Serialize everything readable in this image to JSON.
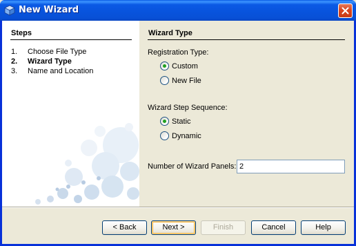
{
  "window": {
    "title": "New Wizard",
    "close_icon": "close-icon",
    "app_icon": "cube-icon"
  },
  "steps": {
    "title": "Steps",
    "items": [
      {
        "num": "1.",
        "label": "Choose File Type"
      },
      {
        "num": "2.",
        "label": "Wizard Type"
      },
      {
        "num": "3.",
        "label": "Name and Location"
      }
    ],
    "current_index": 1
  },
  "content": {
    "title": "Wizard Type",
    "registration": {
      "label": "Registration Type:",
      "options": [
        {
          "label": "Custom",
          "checked": true
        },
        {
          "label": "New File",
          "checked": false
        }
      ]
    },
    "sequence": {
      "label": "Wizard Step Sequence:",
      "options": [
        {
          "label": "Static",
          "checked": true
        },
        {
          "label": "Dynamic",
          "checked": false
        }
      ]
    },
    "panels": {
      "label": "Number of Wizard Panels:",
      "value": "2"
    }
  },
  "buttons": {
    "back": "< Back",
    "next": "Next >",
    "finish": "Finish",
    "cancel": "Cancel",
    "help": "Help"
  },
  "colors": {
    "titlebar": "#0853dc",
    "accent_radio": "#21a121",
    "dialog_bg": "#ece9d8"
  }
}
